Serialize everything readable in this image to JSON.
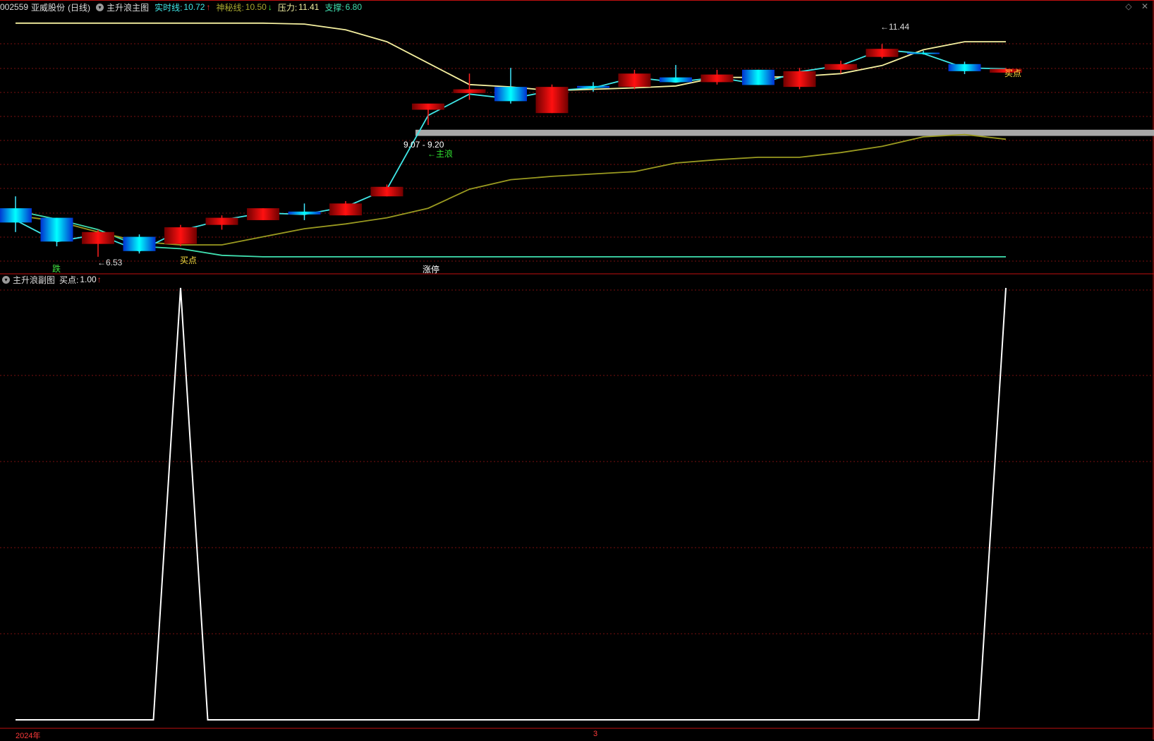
{
  "header": {
    "code": "002559",
    "name": "亚威股份",
    "period": "(日线)",
    "indicator": "主升浪主图",
    "realtime_label": "实时线:",
    "realtime_value": "10.72",
    "realtime_arrow": "↑",
    "mystery_label": "神秘线:",
    "mystery_value": "10.50",
    "mystery_arrow": "↓",
    "pressure_label": "压力:",
    "pressure_value": "11.41",
    "support_label": "支撑:",
    "support_value": "6.80"
  },
  "sub_header": {
    "indicator": "主升浪副图",
    "buy_label": "买点:",
    "buy_value": "1.00",
    "buy_arrow": "↑"
  },
  "annotations": {
    "low": "←6.53",
    "high": "←11.44",
    "range": "9.07 - 9.20",
    "main_wave": "←主浪",
    "buy1": "买点",
    "buy2": "买点",
    "fall": "跌",
    "limit_up": "涨停"
  },
  "x_axis": {
    "year": "2024年",
    "month": "3"
  },
  "colors": {
    "up": "#e00000",
    "down": "#00c8ff",
    "realtime_line": "#40e8e8",
    "mystery_line": "#9a9a20",
    "pressure_line": "#f5f0a0",
    "support_line": "#40e0b0",
    "grid": "#7a1010",
    "frame": "#c01010"
  },
  "chart_data": {
    "type": "candlestick",
    "candles": [
      {
        "o": 7.55,
        "h": 7.8,
        "l": 7.05,
        "c": 7.25
      },
      {
        "o": 7.35,
        "h": 7.35,
        "l": 6.75,
        "c": 6.85
      },
      {
        "o": 6.8,
        "h": 7.1,
        "l": 6.53,
        "c": 7.05
      },
      {
        "o": 6.95,
        "h": 7.0,
        "l": 6.6,
        "c": 6.65
      },
      {
        "o": 6.8,
        "h": 7.2,
        "l": 6.75,
        "c": 7.15
      },
      {
        "o": 7.2,
        "h": 7.4,
        "l": 7.1,
        "c": 7.35
      },
      {
        "o": 7.3,
        "h": 7.55,
        "l": 7.3,
        "c": 7.55
      },
      {
        "o": 7.48,
        "h": 7.65,
        "l": 7.3,
        "c": 7.42
      },
      {
        "o": 7.4,
        "h": 7.7,
        "l": 7.4,
        "c": 7.65
      },
      {
        "o": 7.8,
        "h": 8.05,
        "l": 7.8,
        "c": 8.0
      },
      {
        "o": 9.62,
        "h": 9.62,
        "l": 9.3,
        "c": 9.75
      },
      {
        "o": 9.97,
        "h": 10.38,
        "l": 9.83,
        "c": 10.05
      },
      {
        "o": 10.1,
        "h": 10.5,
        "l": 9.75,
        "c": 9.8
      },
      {
        "o": 9.55,
        "h": 10.15,
        "l": 9.55,
        "c": 10.1
      },
      {
        "o": 10.12,
        "h": 10.2,
        "l": 10.0,
        "c": 10.08
      },
      {
        "o": 10.1,
        "h": 10.46,
        "l": 10.05,
        "c": 10.38
      },
      {
        "o": 10.3,
        "h": 10.56,
        "l": 10.22,
        "c": 10.2
      },
      {
        "o": 10.2,
        "h": 10.46,
        "l": 10.15,
        "c": 10.36
      },
      {
        "o": 10.46,
        "h": 10.46,
        "l": 10.14,
        "c": 10.14
      },
      {
        "o": 10.1,
        "h": 10.5,
        "l": 10.05,
        "c": 10.43
      },
      {
        "o": 10.46,
        "h": 10.65,
        "l": 10.38,
        "c": 10.58
      },
      {
        "o": 10.73,
        "h": 11.0,
        "l": 10.7,
        "c": 10.9
      },
      {
        "o": 10.82,
        "h": 10.86,
        "l": 10.78,
        "c": 10.8
      },
      {
        "o": 10.58,
        "h": 10.63,
        "l": 10.37,
        "c": 10.43
      },
      {
        "o": 10.4,
        "h": 10.5,
        "l": 10.42,
        "c": 10.48
      }
    ],
    "realtime_line": [
      7.3,
      6.85,
      7.0,
      6.65,
      7.08,
      7.3,
      7.45,
      7.42,
      7.58,
      7.95,
      9.5,
      9.95,
      9.85,
      10.02,
      10.08,
      10.3,
      10.2,
      10.3,
      10.16,
      10.42,
      10.55,
      10.88,
      10.8,
      10.5,
      10.48
    ],
    "mystery_line": [
      7.4,
      7.28,
      7.05,
      6.85,
      6.78,
      6.78,
      6.95,
      7.12,
      7.22,
      7.35,
      7.55,
      7.95,
      8.15,
      8.22,
      8.27,
      8.32,
      8.5,
      8.57,
      8.62,
      8.62,
      8.72,
      8.85,
      9.05,
      9.1,
      9.0
    ],
    "pressure_line": [
      11.44,
      11.44,
      11.44,
      11.44,
      11.44,
      11.44,
      11.44,
      11.42,
      11.3,
      11.05,
      10.6,
      10.15,
      10.1,
      10.02,
      10.05,
      10.08,
      10.12,
      10.3,
      10.3,
      10.32,
      10.38,
      10.55,
      10.88,
      11.05,
      11.05
    ],
    "support_line": [
      7.5,
      7.32,
      7.1,
      6.75,
      6.7,
      6.56,
      6.53,
      6.53,
      6.53,
      6.53,
      6.53,
      6.53,
      6.53,
      6.53,
      6.53,
      6.53,
      6.53,
      6.53,
      6.53,
      6.53,
      6.53,
      6.53,
      6.53,
      6.53,
      6.53
    ],
    "range_band": [
      9.07,
      9.2
    ],
    "main_ylim": [
      6.35,
      11.6
    ],
    "sub_buy_signal": [
      0,
      0,
      0,
      0,
      1,
      0,
      0,
      0,
      0,
      0,
      0,
      0,
      0,
      0,
      0,
      0,
      0,
      0,
      0,
      0,
      0,
      0,
      0,
      0,
      1
    ],
    "sub_ylim": [
      0,
      1
    ]
  }
}
